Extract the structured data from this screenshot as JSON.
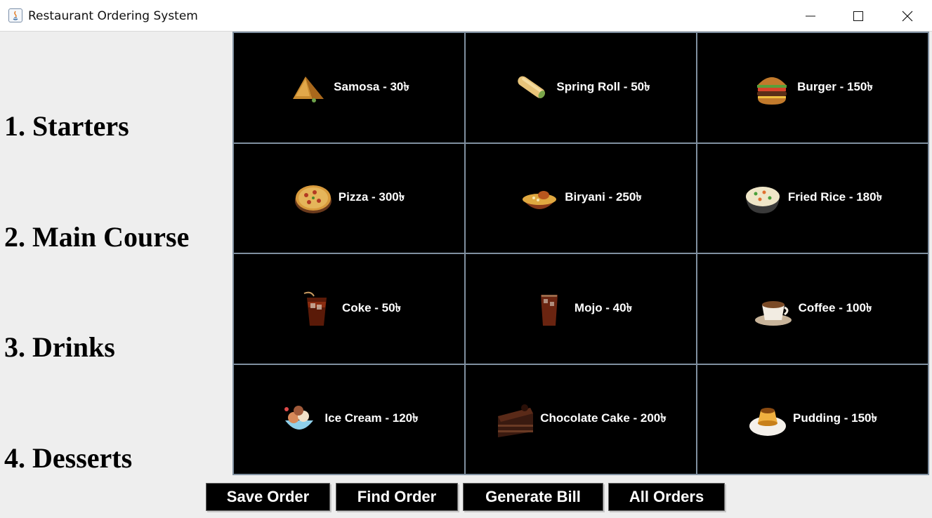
{
  "window": {
    "title": "Restaurant Ordering System"
  },
  "categories": [
    "1. Starters",
    "2. Main Course",
    "3. Drinks",
    "4. Desserts"
  ],
  "menu": [
    {
      "label": "Samosa - 30৳",
      "icon": "samosa-icon"
    },
    {
      "label": "Spring Roll - 50৳",
      "icon": "spring-roll-icon"
    },
    {
      "label": "Burger - 150৳",
      "icon": "burger-icon"
    },
    {
      "label": "Pizza - 300৳",
      "icon": "pizza-icon"
    },
    {
      "label": "Biryani - 250৳",
      "icon": "biryani-icon"
    },
    {
      "label": "Fried Rice - 180৳",
      "icon": "fried-rice-icon"
    },
    {
      "label": "Coke - 50৳",
      "icon": "coke-icon"
    },
    {
      "label": "Mojo - 40৳",
      "icon": "mojo-icon"
    },
    {
      "label": "Coffee - 100৳",
      "icon": "coffee-icon"
    },
    {
      "label": "Ice Cream - 120৳",
      "icon": "ice-cream-icon"
    },
    {
      "label": "Chocolate Cake - 200৳",
      "icon": "chocolate-cake-icon"
    },
    {
      "label": "Pudding - 150৳",
      "icon": "pudding-icon"
    }
  ],
  "buttons": {
    "save": "Save Order",
    "find": "Find Order",
    "bill": "Generate Bill",
    "all": "All Orders"
  }
}
